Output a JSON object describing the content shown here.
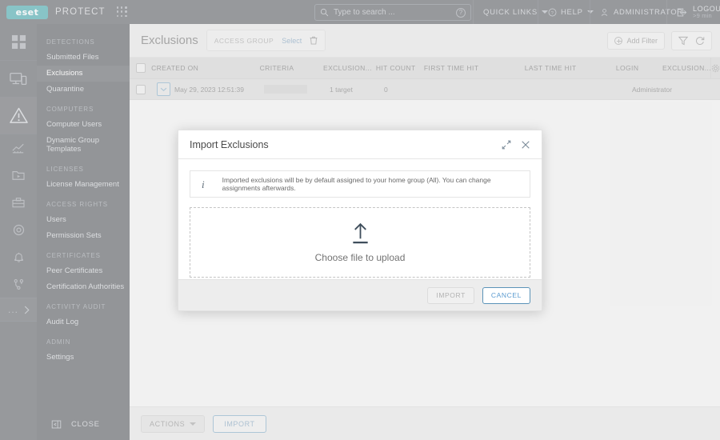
{
  "topbar": {
    "logo_text": "eset",
    "brand": "PROTECT",
    "apps_icon": "apps-grid-icon",
    "search": {
      "placeholder": "Type to search ...",
      "value": "",
      "icon": "search-icon",
      "help_icon": "question-circle-icon"
    },
    "quick_links": "QUICK LINKS",
    "help": "HELP",
    "administrator": "ADMINISTRATOR",
    "logout": "LOGOUT",
    "logout_timer": ">9 min"
  },
  "rail": {
    "items": [
      {
        "name": "dashboard",
        "icon": "grid-dashboard-icon"
      },
      {
        "name": "computers",
        "icon": "monitor-icon"
      },
      {
        "name": "detections",
        "icon": "warning-triangle-icon",
        "active": true
      },
      {
        "name": "reports",
        "icon": "chart-icon"
      },
      {
        "name": "tasks",
        "icon": "folder-play-icon"
      },
      {
        "name": "installers",
        "icon": "box-download-icon"
      },
      {
        "name": "policies",
        "icon": "target-icon"
      },
      {
        "name": "notifications",
        "icon": "bell-icon"
      },
      {
        "name": "status-overview",
        "icon": "branch-icon"
      }
    ],
    "more": "...",
    "more_icon": "chevron-right-icon"
  },
  "sidebar": {
    "groups": [
      {
        "title": "DETECTIONS",
        "items": [
          {
            "label": "Submitted Files",
            "active": false
          },
          {
            "label": "Exclusions",
            "active": true
          },
          {
            "label": "Quarantine",
            "active": false
          }
        ]
      },
      {
        "title": "COMPUTERS",
        "items": [
          {
            "label": "Computer Users",
            "active": false
          },
          {
            "label": "Dynamic Group Templates",
            "active": false
          }
        ]
      },
      {
        "title": "LICENSES",
        "items": [
          {
            "label": "License Management",
            "active": false
          }
        ]
      },
      {
        "title": "ACCESS RIGHTS",
        "items": [
          {
            "label": "Users",
            "active": false
          },
          {
            "label": "Permission Sets",
            "active": false
          }
        ]
      },
      {
        "title": "CERTIFICATES",
        "items": [
          {
            "label": "Peer Certificates",
            "active": false
          },
          {
            "label": "Certification Authorities",
            "active": false
          }
        ]
      },
      {
        "title": "ACTIVITY AUDIT",
        "items": [
          {
            "label": "Audit Log",
            "active": false
          }
        ]
      },
      {
        "title": "ADMIN",
        "items": [
          {
            "label": "Settings",
            "active": false
          }
        ]
      }
    ],
    "close_label": "CLOSE",
    "close_icon": "collapse-panel-icon"
  },
  "page": {
    "title": "Exclusions",
    "access_group_label": "ACCESS GROUP",
    "access_group_select": "Select",
    "access_group_trash_icon": "trash-icon",
    "add_filter": "Add Filter",
    "add_filter_icon": "plus-circle-icon",
    "funnel_icon": "funnel-icon",
    "refresh_icon": "refresh-icon"
  },
  "table": {
    "columns": [
      "CREATED ON",
      "CRITERIA",
      "EXCLUSION...",
      "HIT COUNT",
      "FIRST TIME HIT",
      "LAST TIME HIT",
      "LOGIN",
      "EXCLUSION..."
    ],
    "gear_icon": "gear-icon",
    "select_all_icon": "checkbox-icon",
    "rows": [
      {
        "checkbox": "checkbox-icon",
        "expand_icon": "chevron-down-icon",
        "created_on": "May 29, 2023 12:51:39",
        "criteria": "",
        "criteria_redacted": true,
        "exclusion": "1 target",
        "hit_count": "0",
        "first_time_hit": "",
        "last_time_hit": "",
        "login": "Administrator",
        "exclusion_2": ""
      }
    ]
  },
  "bottombar": {
    "actions_label": "ACTIONS",
    "actions_caret_icon": "caret-down-icon",
    "import_label": "IMPORT"
  },
  "modal": {
    "title": "Import Exclusions",
    "expand_icon": "expand-diagonal-icon",
    "close_icon": "close-x-icon",
    "info_icon": "info-icon",
    "info_text": "Imported exclusions will be by default assigned to your home group (All). You can change assignments afterwards.",
    "upload_icon": "upload-arrow-icon",
    "dropzone_label": "Choose file to upload",
    "import_label": "IMPORT",
    "cancel_label": "CANCEL"
  },
  "colors": {
    "brand_teal": "#0b8f95",
    "dark_chrome": "#2b2f36",
    "sidebar_dark": "#23272d",
    "accent_blue": "#5b93b8",
    "link_blue": "#5b87ad"
  }
}
